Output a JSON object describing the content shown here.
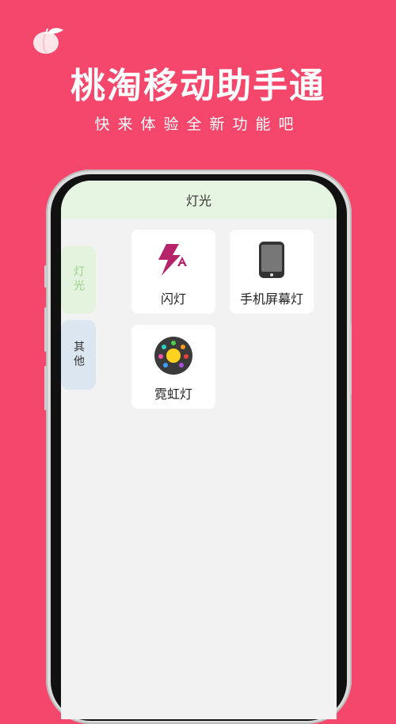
{
  "promo": {
    "headline": "桃淘移动助手通",
    "tagline": "快来体验全新功能吧"
  },
  "app": {
    "header_title": "灯光",
    "side_tabs": [
      {
        "label": "灯光",
        "selected": true
      },
      {
        "label": "其他",
        "selected": false
      }
    ],
    "tools": [
      {
        "label": "闪灯",
        "icon": "flash-icon"
      },
      {
        "label": "手机屏幕灯",
        "icon": "phone-screen-icon"
      },
      {
        "label": "霓虹灯",
        "icon": "neon-light-icon"
      }
    ]
  },
  "colors": {
    "background": "#f5476b",
    "header": "#e6f5e1",
    "flash_icon": "#b5246a"
  }
}
